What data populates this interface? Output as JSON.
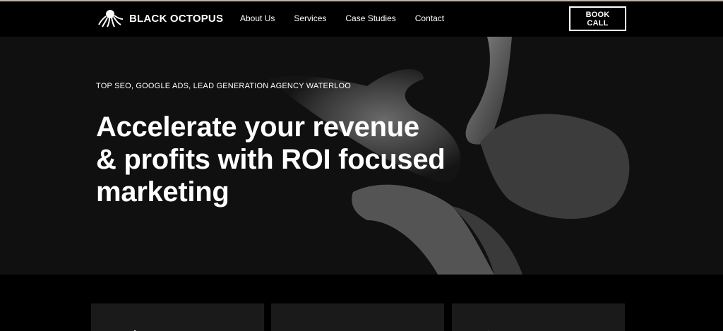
{
  "brand": {
    "name": "BLACK OCTOPUS",
    "logo_icon": "octopus-logo-icon"
  },
  "nav": {
    "items": [
      {
        "label": "About Us"
      },
      {
        "label": "Services"
      },
      {
        "label": "Case Studies"
      },
      {
        "label": "Contact"
      }
    ],
    "cta_label": "BOOK CALL"
  },
  "hero": {
    "eyebrow": "TOP SEO, GOOGLE ADS, LEAD GENERATION AGENCY WATERLOO",
    "headline_lines": [
      "Accelerate your revenue",
      "& profits with ROI focused",
      "marketing"
    ],
    "background_image": "octopus-photo"
  },
  "feature_cards": [
    {
      "icon": "feature-icon-1"
    },
    {
      "icon": "heart-icon"
    },
    {
      "icon": "feature-icon-3"
    }
  ],
  "colors": {
    "background": "#000000",
    "hero_background": "#101010",
    "card_background": "#1a1a1a",
    "text": "#ffffff",
    "top_line": "#b9b3ab"
  }
}
